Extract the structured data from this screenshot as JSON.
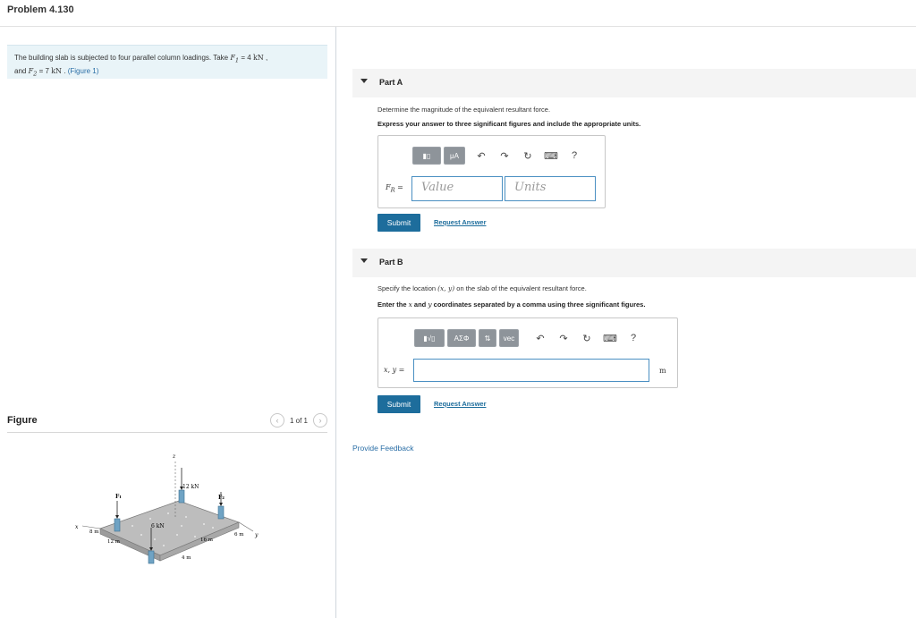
{
  "header": {
    "title": "Problem 4.130"
  },
  "statement": {
    "text1": "The building slab is subjected to four parallel column loadings. Take ",
    "f1_sym": "F",
    "f1_sub": "1",
    "f1_eq": " = 4 ",
    "unit1": "kN",
    "comma": " ,",
    "text2": "and ",
    "f2_sym": "F",
    "f2_sub": "2",
    "f2_eq": " = 7 ",
    "unit2": "kN",
    "dot": " . ",
    "figure_link": "(Figure 1)"
  },
  "figure": {
    "label": "Figure",
    "pager_text": "1 of 1",
    "prev_icon": "‹",
    "next_icon": "›",
    "labels": {
      "z": "z",
      "kn12": "12 kN",
      "f1": "F₁",
      "f2": "F₂",
      "kn6": "6 kN",
      "x": "x",
      "y": "y",
      "m8": "8 m",
      "m12": "12 m",
      "m16": "16 m",
      "m6": "6 m",
      "m4": "4 m"
    }
  },
  "partA": {
    "label": "Part A",
    "instruction": "Determine the magnitude of the equivalent resultant force.",
    "bold_instruction": "Express your answer to three significant figures and include the appropriate units.",
    "toolbar": {
      "matrix": "▮▯",
      "mu": "μA",
      "undo": "↶",
      "redo": "↷",
      "reset": "↻",
      "keyboard": "⌨",
      "help": "?"
    },
    "field_label": "F",
    "field_sub": "R",
    "field_eq": " =",
    "value_placeholder": "Value",
    "units_placeholder": "Units",
    "submit": "Submit",
    "request": "Request Answer"
  },
  "partB": {
    "label": "Part B",
    "instruction_a": "Specify the location ",
    "instruction_m": "(x, y)",
    "instruction_b": " on the slab of the equivalent resultant force.",
    "bold_a": "Enter the ",
    "bold_x": "x",
    "bold_b": " and ",
    "bold_y": "y",
    "bold_c": " coordinates separated by a comma using three significant figures.",
    "toolbar": {
      "templates": "▮√▯",
      "greek": "ΑΣΦ",
      "arrows": "⇅",
      "vec": "vec",
      "undo": "↶",
      "redo": "↷",
      "reset": "↻",
      "keyboard": "⌨",
      "help": "?"
    },
    "field_label": "x, y =",
    "unit": "m",
    "submit": "Submit",
    "request": "Request Answer"
  },
  "feedback": "Provide Feedback"
}
